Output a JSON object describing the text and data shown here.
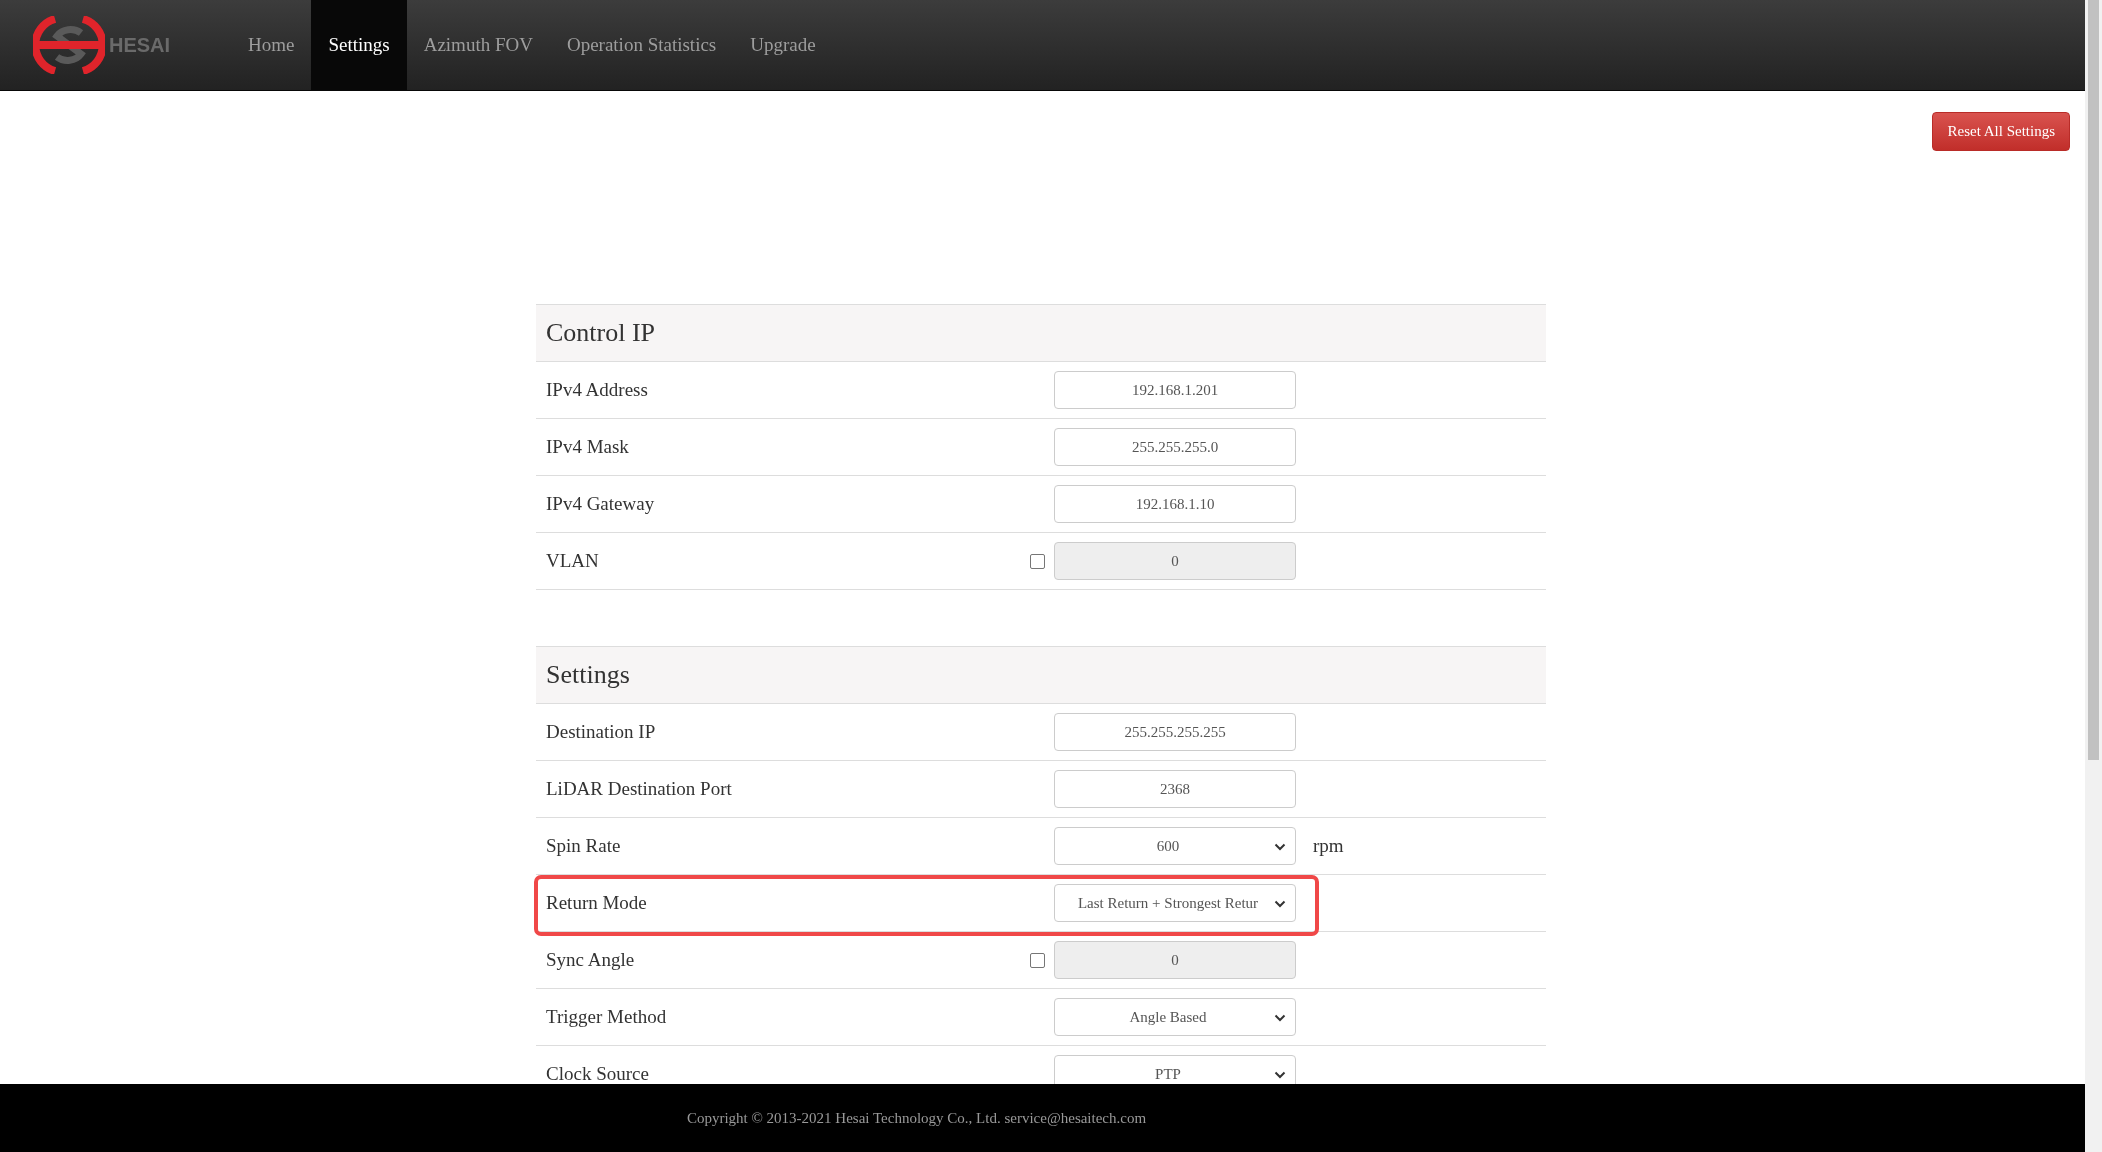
{
  "logo": {
    "text": "HESAI"
  },
  "nav": [
    {
      "label": "Home",
      "selected": false
    },
    {
      "label": "Settings",
      "selected": true
    },
    {
      "label": "Azimuth FOV",
      "selected": false
    },
    {
      "label": "Operation Statistics",
      "selected": false
    },
    {
      "label": "Upgrade",
      "selected": false
    }
  ],
  "reset_button": "Reset All Settings",
  "sections": [
    {
      "title": "Control IP",
      "rows": [
        {
          "kind": "text",
          "label": "IPv4 Address",
          "value": "192.168.1.201",
          "highlighted": false
        },
        {
          "kind": "text",
          "label": "IPv4 Mask",
          "value": "255.255.255.0",
          "highlighted": false
        },
        {
          "kind": "text",
          "label": "IPv4 Gateway",
          "value": "192.168.1.10",
          "highlighted": false
        },
        {
          "kind": "check",
          "label": "VLAN",
          "value": "0",
          "checked": false,
          "highlighted": false
        }
      ]
    },
    {
      "title": "Settings",
      "rows": [
        {
          "kind": "text",
          "label": "Destination IP",
          "value": "255.255.255.255",
          "highlighted": false
        },
        {
          "kind": "text",
          "label": "LiDAR Destination Port",
          "value": "2368",
          "highlighted": false
        },
        {
          "kind": "select",
          "label": "Spin Rate",
          "value": "600",
          "unit": "rpm",
          "highlighted": false
        },
        {
          "kind": "select",
          "label": "Return Mode",
          "value": "Last Return + Strongest Retur",
          "highlighted": true
        },
        {
          "kind": "check",
          "label": "Sync Angle",
          "value": "0",
          "checked": false,
          "highlighted": false
        },
        {
          "kind": "select",
          "label": "Trigger Method",
          "value": "Angle Based",
          "highlighted": false
        },
        {
          "kind": "select",
          "label": "Clock Source",
          "value": "PTP",
          "highlighted": false
        }
      ]
    }
  ],
  "footer": "Copyright © 2013-2021 Hesai Technology Co., Ltd. service@hesaitech.com"
}
